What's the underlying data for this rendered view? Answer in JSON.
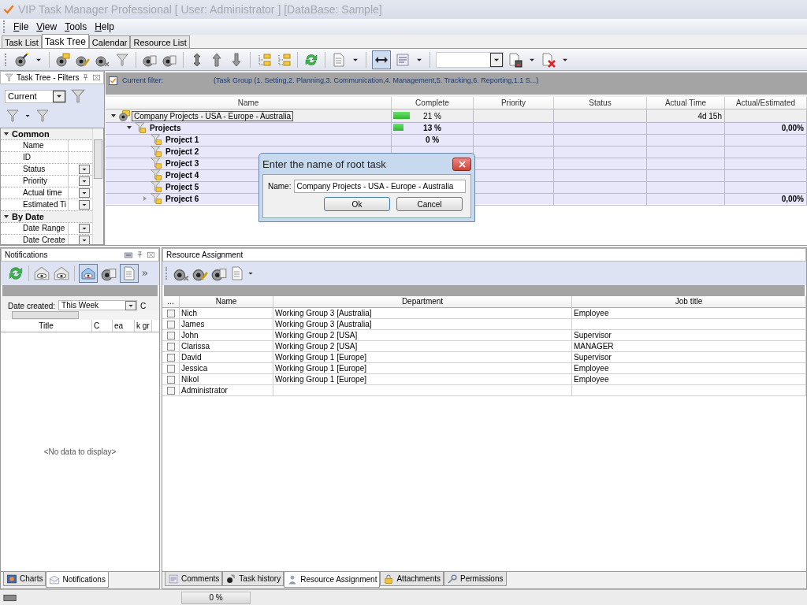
{
  "window": {
    "title": "VIP Task Manager Professional [ User: Administrator ] [DataBase: Sample]"
  },
  "menu": [
    "File",
    "View",
    "Tools",
    "Help"
  ],
  "tabs": [
    {
      "label": "Task List",
      "selected": false
    },
    {
      "label": "Task Tree",
      "selected": true
    },
    {
      "label": "Calendar",
      "selected": false
    },
    {
      "label": "Resource List",
      "selected": false
    }
  ],
  "filters_panel": {
    "title": "Task Tree - Filters",
    "filter_combo": "Current",
    "groups": [
      {
        "name": "Common",
        "expanded": true,
        "items": [
          {
            "name": "Name",
            "dropdown": false
          },
          {
            "name": "ID",
            "dropdown": false
          },
          {
            "name": "Status",
            "dropdown": true
          },
          {
            "name": "Priority",
            "dropdown": true
          },
          {
            "name": "Actual time",
            "dropdown": true
          },
          {
            "name": "Estimated Ti",
            "dropdown": true
          }
        ]
      },
      {
        "name": "By Date",
        "expanded": true,
        "items": [
          {
            "name": "Date Range",
            "dropdown": true
          },
          {
            "name": "Date Create",
            "dropdown": true
          }
        ]
      }
    ]
  },
  "current_filter": {
    "checked": true,
    "label": "Current filter:",
    "text": "(Task Group  (1. Setting,2. Planning,3. Communication,4. Management,5. Tracking,6. Reporting,1.1 S...)"
  },
  "task_tree": {
    "columns": [
      "Name",
      "Complete",
      "Priority",
      "Status",
      "Actual Time",
      "Actual/Estimated"
    ],
    "rows": [
      {
        "kind": "root",
        "name": "Company Projects - USA - Europe - Australia",
        "complete": "21 %",
        "level": 0.21,
        "actual_time": "4d 15h",
        "expanded": true,
        "selected": true,
        "children": [
          {
            "kind": "group",
            "name": "Projects",
            "complete": "13 %",
            "level": 0.13,
            "actual_estimated": "0,00%",
            "expanded": true,
            "selected": false,
            "children": [
              {
                "kind": "group",
                "name": "Project 1",
                "complete": "0 %",
                "selected": false
              },
              {
                "kind": "group",
                "name": "Project 2",
                "selected": false
              },
              {
                "kind": "group",
                "name": "Project 3",
                "selected": false
              },
              {
                "kind": "group",
                "name": "Project 4",
                "selected": false
              },
              {
                "kind": "group",
                "name": "Project 5",
                "selected": false
              },
              {
                "kind": "group",
                "name": "Project 6",
                "actual_estimated": "0,00%",
                "expanded": false,
                "selected": false
              }
            ]
          }
        ]
      }
    ]
  },
  "dialog": {
    "title": "Enter the name of root task",
    "name_label": "Name:",
    "name_value": "Company Projects - USA - Europe - Australia",
    "buttons": [
      "Ok",
      "Cancel"
    ]
  },
  "notifications_panel": {
    "title": "Notifications",
    "date_label": "Date created:",
    "date_value": "This Week",
    "date_extra": "C",
    "columns": [
      "Title",
      "C",
      "ea",
      "k gr"
    ],
    "empty_text": "<No data to display>"
  },
  "resource_panel": {
    "title": "Resource Assignment",
    "columns": [
      "...",
      "Name",
      "Department",
      "Job title"
    ],
    "rows": [
      {
        "checked": false,
        "name": "Nich",
        "department": "Working Group 3 [Australia]",
        "job_title": "Employee"
      },
      {
        "checked": false,
        "name": "James",
        "department": "Working Group 3 [Australia]"
      },
      {
        "checked": false,
        "name": "John",
        "department": "Working Group 2 [USA]",
        "job_title": "Supervisor"
      },
      {
        "checked": false,
        "name": "Clarissa",
        "department": "Working Group 2 [USA]",
        "job_title": "MANAGER"
      },
      {
        "checked": false,
        "name": "David",
        "department": "Working Group 1 [Europe]",
        "job_title": "Supervisor"
      },
      {
        "checked": false,
        "name": "Jessica",
        "department": "Working Group 1 [Europe]",
        "job_title": "Employee"
      },
      {
        "checked": false,
        "name": "Nikol",
        "department": "Working Group 1 [Europe]",
        "job_title": "Employee"
      },
      {
        "checked": false,
        "name": "Administrator"
      }
    ]
  },
  "bottom_tabs_left": [
    {
      "label": "Charts",
      "selected": false
    },
    {
      "label": "Notifications",
      "selected": true
    }
  ],
  "bottom_tabs_right": [
    {
      "label": "Comments",
      "selected": false
    },
    {
      "label": "Task history",
      "selected": false
    },
    {
      "label": "Resource Assignment",
      "selected": true
    },
    {
      "label": "Attachments",
      "selected": false
    },
    {
      "label": "Permissions",
      "selected": false
    }
  ],
  "status_bar": {
    "progress": {
      "level": 0,
      "text": "0 %"
    }
  }
}
